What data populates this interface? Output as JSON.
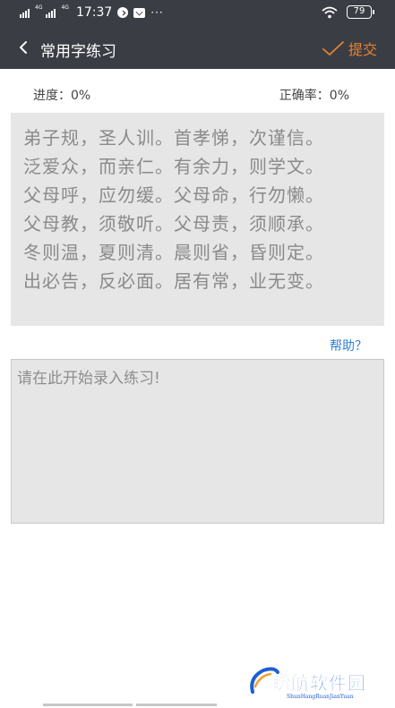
{
  "status_bar": {
    "signal_1_label": "4G",
    "signal_2_label": "4G",
    "time": "17:37",
    "more": "···",
    "battery": "79",
    "icons": [
      "signal-icon",
      "signal-icon",
      "check-circle-icon",
      "mail-icon",
      "wifi-icon",
      "battery-icon"
    ]
  },
  "header": {
    "title": "常用字练习",
    "submit_label": "提交",
    "accent_color": "#e9822f",
    "bar_color": "#3a3d44"
  },
  "stats": {
    "progress": "进度：0%",
    "accuracy": "正确率：0%"
  },
  "practice_text": {
    "lines": [
      "弟子规，圣人训。首孝悌，次谨信。",
      "泛爱众，而亲仁。有余力，则学文。",
      "父母呼，应勿缓。父母命，行勿懒。",
      "父母教，须敬听。父母责，须顺承。",
      "冬则温，夏则清。晨则省，昏则定。",
      "出必告，反必面。居有常，业无变。"
    ]
  },
  "help": {
    "label": "帮助？",
    "color": "#2f7fd6"
  },
  "input": {
    "placeholder": "请在此开始录入练习!",
    "value": ""
  },
  "watermark": {
    "text": "瞬航软件园",
    "subtext": "ShunHangRuanJianYuan"
  }
}
